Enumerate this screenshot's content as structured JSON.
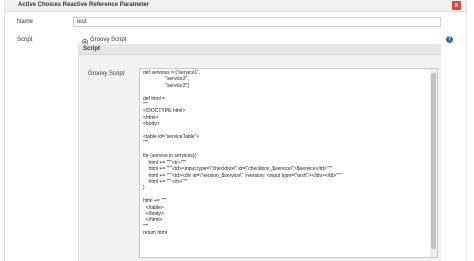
{
  "header": {
    "title": "Active Choices Reactive Reference Parameter",
    "close_label": "x"
  },
  "name_field": {
    "label": "Name",
    "value": "test"
  },
  "script_section": {
    "label": "Script",
    "option_label": "Groovy Script",
    "option_selected": true,
    "help_label": "?"
  },
  "script_panel": {
    "title": "Script",
    "groovy_label": "Groovy Script",
    "code_lines": [
      "def services = [\"service1\",",
      "                \"service2\",",
      "                \"service3\"]",
      "",
      "def html =",
      "\"\"\"",
      "<!DOCTYPE html>",
      "<html>",
      "<body>",
      "",
      "<table id=\"serviceTable\">",
      "\"\"\"",
      "",
      "for (service in services){",
      "    html += \"\"\"<tr>\"\"\"",
      "    html += \"\"\"<td><input type=\\\"checkbox\\\" id=\\\"checkbox_$service\\\">$service</td>\"\"\"",
      "    html += \"\"\"<td><div id=\\\"version_$service\\\" >version: <input type=\\\"text\\\"></div></td>\"\"\"",
      "    html += \"\"\"</tr>\"\"\"",
      "}",
      "",
      "html += \"\"\"",
      "  </table>",
      "  </body>",
      "  </html>",
      "\"\"\"",
      "return html"
    ]
  },
  "colors": {
    "header_bg": "#f0f0f0",
    "close_button": "#d24939",
    "help_icon": "#2f6fb3",
    "panel_bg": "#f2f2f2"
  }
}
